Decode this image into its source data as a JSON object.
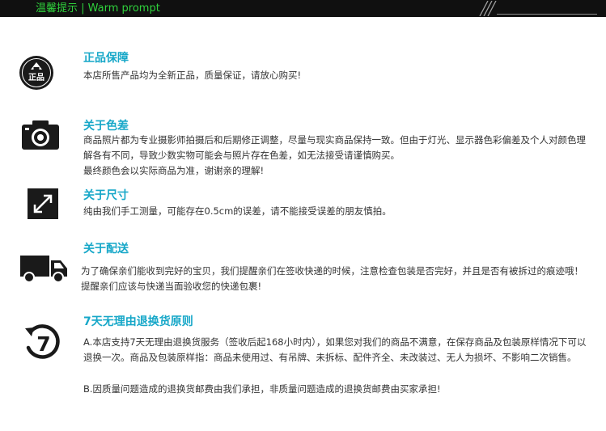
{
  "header": {
    "title": "温馨提示  | Warm prompt"
  },
  "sections": [
    {
      "icon": "authentic-badge-icon",
      "badge_text": "正品",
      "title": "正品保障",
      "lines": [
        "本店所售产品均为全新正品，质量保证，请放心购买!"
      ]
    },
    {
      "icon": "camera-icon",
      "title": "关于色差",
      "lines": [
        "商品照片都为专业摄影师拍摄后和后期修正调整，尽量与现实商品保持一致。但由于灯光、显示器色彩偏差及个人对颜色理解各有不同，导致少数实物可能会与照片存在色差，如无法接受请谨慎购买。",
        "最终颜色会以实际商品为准，谢谢亲的理解!"
      ]
    },
    {
      "icon": "resize-arrow-icon",
      "title": "关于尺寸",
      "lines": [
        "纯由我们手工测量，可能存在0.5cm的误差，请不能接受误差的朋友慎拍。"
      ]
    },
    {
      "icon": "truck-icon",
      "title": "关于配送",
      "lines": [
        "为了确保亲们能收到完好的宝贝，我们提醒亲们在签收快递的时候，注意检查包装是否完好，并且是否有被拆过的痕迹哦！提醒亲们应该与快递当面验收您的快递包裹!"
      ]
    },
    {
      "icon": "seven-day-return-icon",
      "badge_text": "7",
      "title": "7天无理由退换货原则",
      "lines": [
        "A.本店支持7天无理由退换货服务（签收后起168小时内），如果您对我们的商品不满意，在保存商品及包装原样情况下可以退换一次。商品及包装原样指：商品未使用过、有吊牌、未拆标、配件齐全、未改装过、无人为损坏、不影响二次销售。",
        "B.因质量问题造成的退换货邮费由我们承担，非质量问题造成的退换货邮费由买家承担!"
      ]
    }
  ]
}
